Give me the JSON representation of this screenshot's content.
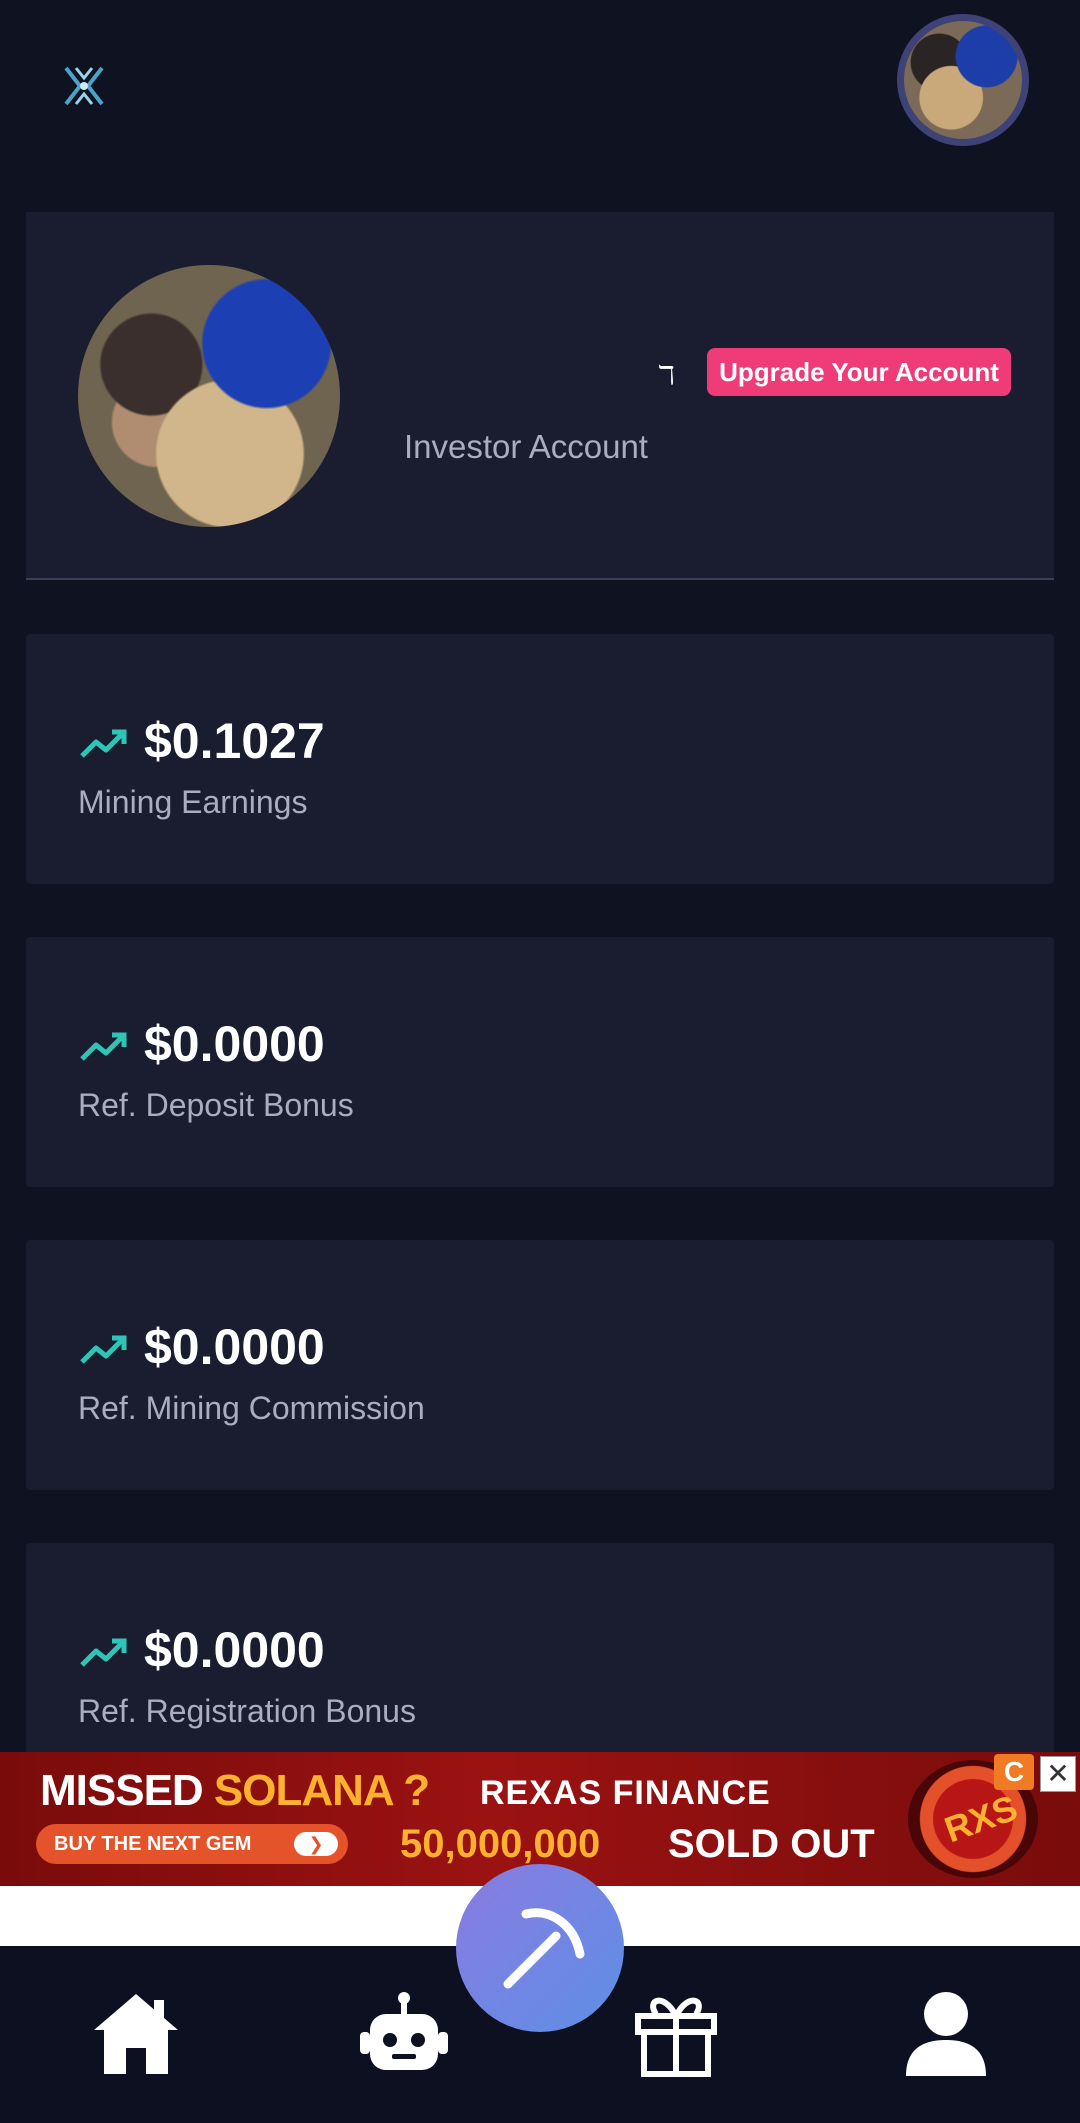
{
  "header": {
    "logo_icon": "x-logo-icon",
    "avatar_icon": "user-avatar-icon"
  },
  "profile": {
    "name_mark": "ℸ",
    "upgrade_label": "Upgrade Your Account",
    "account_type": "Investor Account"
  },
  "stats": [
    {
      "value": "$0.1027",
      "label": "Mining Earnings"
    },
    {
      "value": "$0.0000",
      "label": "Ref. Deposit Bonus"
    },
    {
      "value": "$0.0000",
      "label": "Ref. Mining Commission"
    },
    {
      "value": "$0.0000",
      "label": "Ref. Registration Bonus"
    }
  ],
  "ad": {
    "missed": "MISSED ",
    "solana": "SOLANA ?",
    "cta": "BUY THE NEXT GEM",
    "brand": "REXAS FINANCE",
    "amount": "50,000,000",
    "sold": "SOLD OUT",
    "coin": "RXS",
    "badge": "C",
    "close": "✕"
  },
  "nav": {
    "items": [
      "home-icon",
      "robot-icon",
      "pickaxe-icon",
      "gift-icon",
      "user-icon"
    ]
  },
  "colors": {
    "background": "#0f1220",
    "card": "#1a1d30",
    "accent_pink": "#ef3c78",
    "trend_teal": "#2ec4b6"
  }
}
